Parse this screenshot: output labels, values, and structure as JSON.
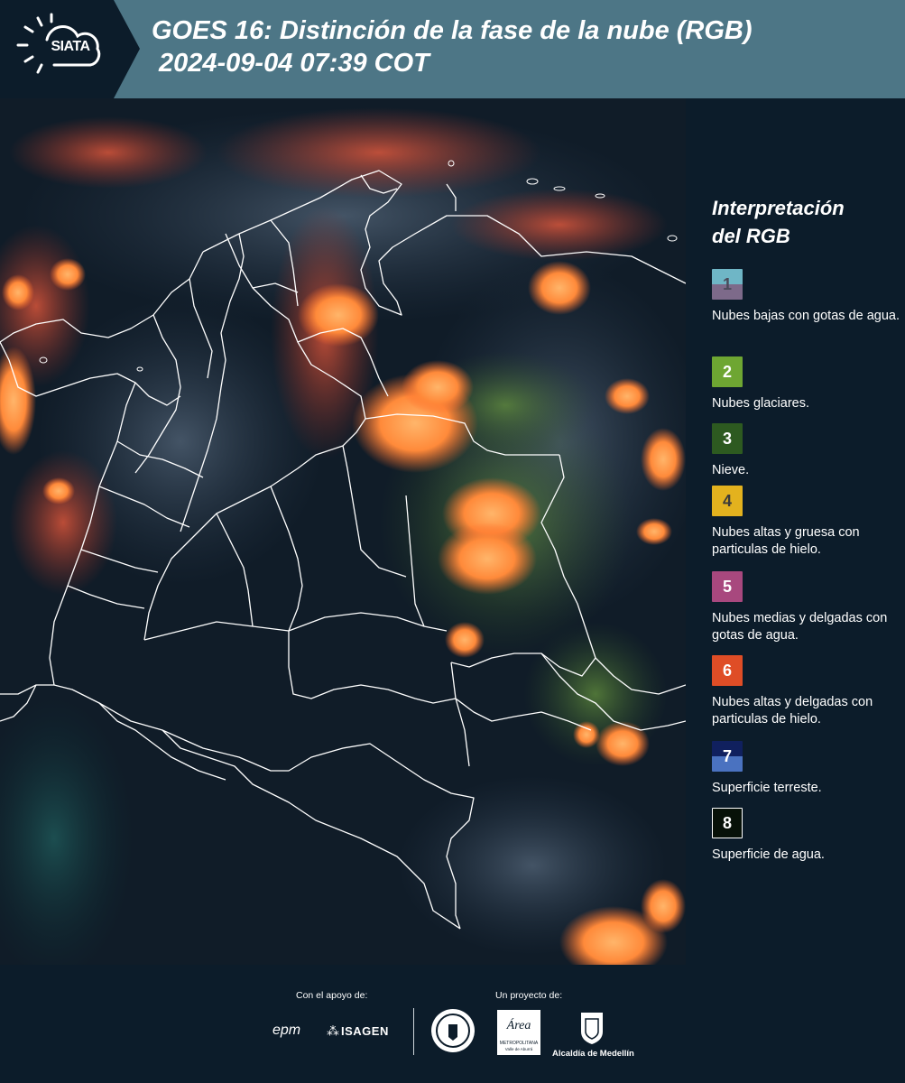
{
  "header": {
    "logo_text": "SIATA",
    "title_line1": "GOES 16: Distinción de la fase de la nube (RGB)",
    "title_line2": "2024-09-04 07:39 COT",
    "background_color": "#4d7686"
  },
  "map": {
    "type": "satellite RGB composite",
    "outline_color": "#ffffff"
  },
  "legend": {
    "title_line1": "Interpretación",
    "title_line2": "del RGB",
    "items": [
      {
        "number": "1",
        "label": "Nubes bajas con gotas de agua.",
        "colors": [
          "#6fb6c6",
          "#7d6a8a"
        ],
        "number_color": "#4a4a5a"
      },
      {
        "number": "2",
        "label": "Nubes glaciares.",
        "colors": [
          "#6ea632"
        ],
        "number_color": "#ffffff"
      },
      {
        "number": "3",
        "label": "Nieve.",
        "colors": [
          "#2d5a20"
        ],
        "number_color": "#ffffff"
      },
      {
        "number": "4",
        "label": "Nubes altas y gruesa con particulas de hielo.",
        "colors": [
          "#e3b21e"
        ],
        "number_color": "#3a3a3a"
      },
      {
        "number": "5",
        "label": "Nubes medias y delgadas con gotas de agua.",
        "colors": [
          "#a8487e"
        ],
        "number_color": "#ffffff"
      },
      {
        "number": "6",
        "label": "Nubes altas y delgadas con particulas de hielo.",
        "colors": [
          "#df4d26"
        ],
        "number_color": "#ffffff"
      },
      {
        "number": "7",
        "label": "Superficie terreste.",
        "colors": [
          "#10205e",
          "#4a72c0"
        ],
        "number_color": "#ffffff"
      },
      {
        "number": "8",
        "label": "Superficie de agua.",
        "colors": [
          "#071108"
        ],
        "number_color": "#ffffff"
      }
    ]
  },
  "footer": {
    "support_label": "Con el apoyo de:",
    "project_label": "Un proyecto de:",
    "sponsors": [
      "epm",
      "ISAGEN"
    ],
    "partners": [
      "Área Metropolitana Valle de Aburrá",
      "Alcaldía de Medellín"
    ],
    "partner_sublabel": "METROPOLITANA",
    "partner_sublabel2": "Valle de Aburrá"
  }
}
